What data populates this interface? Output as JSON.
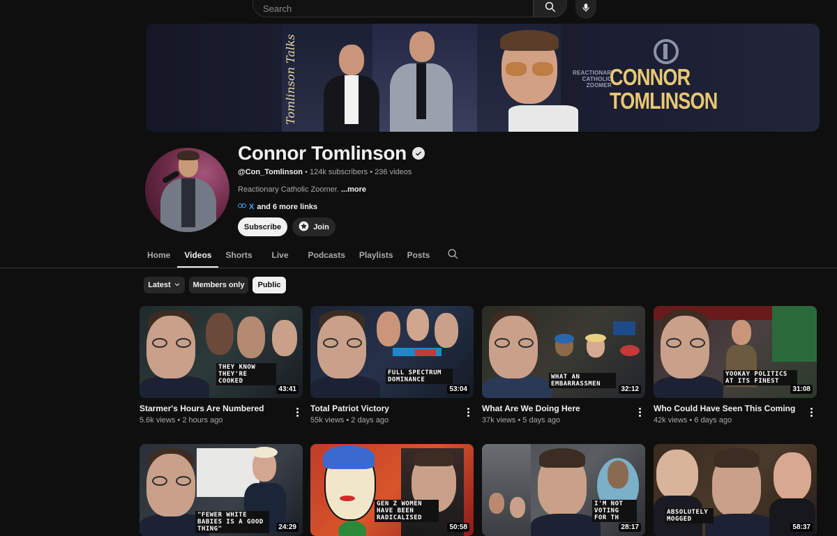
{
  "search": {
    "placeholder": "Search"
  },
  "banner": {
    "script_text": "Tomlinson Talks",
    "tagline": "REACTIONARY CATHOLIC ZOOMER",
    "name_line1": "CONNOR",
    "name_line2": "TOMLINSON"
  },
  "channel": {
    "name": "Connor Tomlinson",
    "handle": "@Con_Tomlinson",
    "subscribers": "124k subscribers",
    "videos": "236 videos",
    "description": "Reactionary Catholic Zoomer.",
    "more_label": "...more",
    "link_primary": "X",
    "link_more": "and 6 more links",
    "subscribe_label": "Subscribe",
    "join_label": "Join"
  },
  "tabs": [
    "Home",
    "Videos",
    "Shorts",
    "Live",
    "Podcasts",
    "Playlists",
    "Posts"
  ],
  "active_tab": "Videos",
  "chips": {
    "latest": "Latest",
    "members": "Members only",
    "public": "Public"
  },
  "videos": [
    {
      "title": "Starmer's Hours Are Numbered",
      "views": "5.6k views",
      "age": "2 hours ago",
      "duration": "43:41",
      "caption": "THEY KNOW THEY'RE COOKED"
    },
    {
      "title": "Total Patriot Victory",
      "views": "55k views",
      "age": "2 days ago",
      "duration": "53:04",
      "caption": "FULL SPECTRUM DOMINANCE"
    },
    {
      "title": "What Are We Doing Here",
      "views": "37k views",
      "age": "5 days ago",
      "duration": "32:12",
      "caption": "WHAT AN EMBARRASSMEN"
    },
    {
      "title": "Who Could Have Seen This Coming",
      "views": "42k views",
      "age": "6 days ago",
      "duration": "31:08",
      "caption": "YOOKAY POLITICS AT ITS FINEST"
    },
    {
      "title": "",
      "views": "",
      "age": "",
      "duration": "24:29",
      "caption": "\"FEWER WHITE BABIES IS A GOOD THING\""
    },
    {
      "title": "",
      "views": "",
      "age": "",
      "duration": "50:58",
      "caption": "GEN Z WOMEN HAVE BEEN RADICALISED"
    },
    {
      "title": "",
      "views": "",
      "age": "",
      "duration": "28:17",
      "caption": "I'M NOT VOTING FOR TH"
    },
    {
      "title": "",
      "views": "",
      "age": "",
      "duration": "58:37",
      "caption": "ABSOLUTELY MOGGED"
    }
  ],
  "colors": {
    "background": "#0f0f0f",
    "accent": "#f1f1f1",
    "banner_gold": "#e9c774"
  }
}
